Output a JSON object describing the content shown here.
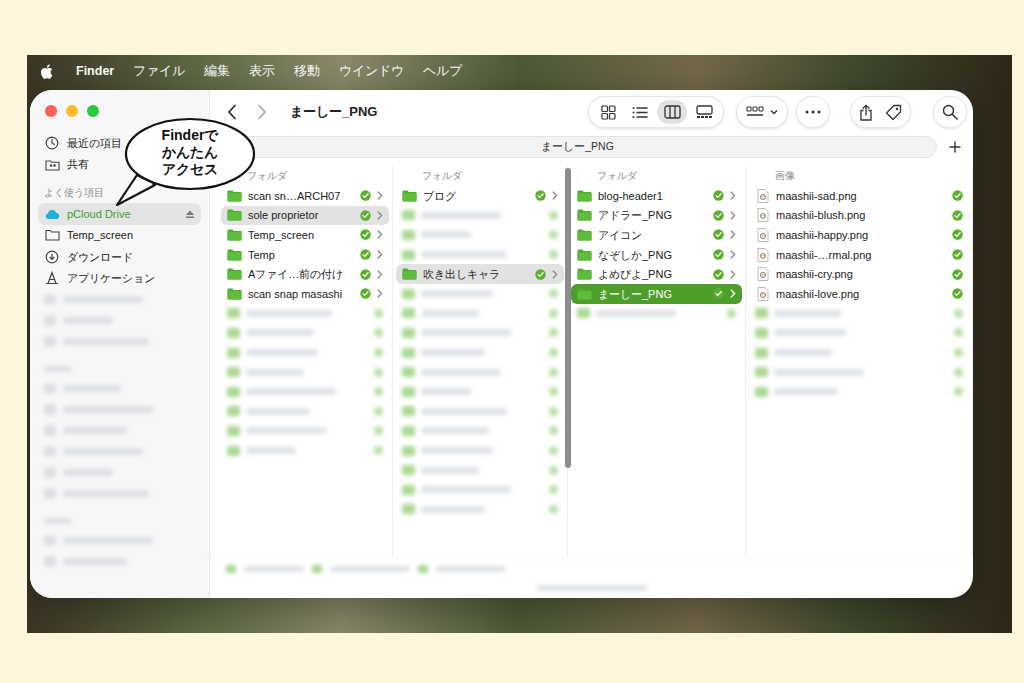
{
  "menu_bar": {
    "app": "Finder",
    "menus": [
      "ファイル",
      "編集",
      "表示",
      "移動",
      "ウインドウ",
      "ヘルプ"
    ]
  },
  "callout": {
    "lines": [
      "Finderで",
      "かんたん",
      "アクセス"
    ]
  },
  "window": {
    "title": "まーしー_PNG"
  },
  "toolbar": {
    "views": [
      {
        "selected": false
      },
      {
        "selected": false
      },
      {
        "selected": true
      },
      {
        "selected": false
      }
    ]
  },
  "path_bar": {
    "label": "まーしー_PNG"
  },
  "sidebar": {
    "top_items": [
      {
        "label": "最近の項目",
        "selected": false
      },
      {
        "label": "共有",
        "selected": false
      }
    ],
    "sections": [
      {
        "kind": "normal",
        "title": "よく使う項目",
        "items": [
          {
            "kind": "item",
            "label": "pCloud Drive",
            "selected": true,
            "ejectable": true
          },
          {
            "kind": "item",
            "label": "Temp_screen",
            "selected": false,
            "ejectable": false
          },
          {
            "kind": "item",
            "label": "ダウンロード",
            "selected": false,
            "ejectable": false
          },
          {
            "kind": "item",
            "label": "アプリケーション",
            "selected": false,
            "ejectable": false
          },
          {
            "kind": "blurred",
            "selected": false
          },
          {
            "kind": "blurred",
            "selected": false
          },
          {
            "kind": "blurred",
            "selected": false
          }
        ]
      },
      {
        "kind": "blurred",
        "items": [
          {
            "kind": "blurred",
            "selected": false
          },
          {
            "kind": "blurred",
            "selected": false
          },
          {
            "kind": "blurred",
            "selected": false
          },
          {
            "kind": "blurred",
            "selected": false
          },
          {
            "kind": "blurred",
            "selected": false
          },
          {
            "kind": "blurred",
            "selected": false
          }
        ]
      },
      {
        "kind": "blurred",
        "items": [
          {
            "kind": "blurred",
            "selected": false
          },
          {
            "kind": "blurred",
            "selected": false
          }
        ]
      }
    ]
  },
  "columns": [
    {
      "header": "フォルダ",
      "focused": false,
      "items": [
        {
          "kind": "folder",
          "label": "scan sn…ARCH07",
          "selected": false,
          "synced": true
        },
        {
          "kind": "folder",
          "label": "sole proprietor",
          "selected": true,
          "synced": true
        },
        {
          "kind": "folder",
          "label": "Temp_screen",
          "selected": false,
          "synced": true
        },
        {
          "kind": "folder",
          "label": "Temp",
          "selected": false,
          "synced": true
        },
        {
          "kind": "folder",
          "label": "Aファイ…前の付け",
          "selected": false,
          "synced": true
        },
        {
          "kind": "folder",
          "label": "scan snap masashi",
          "selected": false,
          "synced": true
        },
        {
          "kind": "blurred",
          "selected": false
        },
        {
          "kind": "blurred",
          "selected": false
        },
        {
          "kind": "blurred",
          "selected": false
        },
        {
          "kind": "blurred",
          "selected": false
        },
        {
          "kind": "blurred",
          "selected": false
        },
        {
          "kind": "blurred",
          "selected": false
        },
        {
          "kind": "blurred",
          "selected": false
        },
        {
          "kind": "blurred",
          "selected": false
        }
      ]
    },
    {
      "header": "フォルダ",
      "focused": false,
      "items": [
        {
          "kind": "folder",
          "label": "ブログ",
          "selected": false,
          "synced": true
        },
        {
          "kind": "blurred",
          "selected": false
        },
        {
          "kind": "blurred",
          "selected": false
        },
        {
          "kind": "blurred",
          "selected": false
        },
        {
          "kind": "folder",
          "label": "吹き出しキャラ",
          "selected": true,
          "synced": true
        },
        {
          "kind": "blurred",
          "selected": false
        },
        {
          "kind": "blurred",
          "selected": false
        },
        {
          "kind": "blurred",
          "selected": false
        },
        {
          "kind": "blurred",
          "selected": false
        },
        {
          "kind": "blurred",
          "selected": false
        },
        {
          "kind": "blurred",
          "selected": false
        },
        {
          "kind": "blurred",
          "selected": false
        },
        {
          "kind": "blurred",
          "selected": false
        },
        {
          "kind": "blurred",
          "selected": false
        },
        {
          "kind": "blurred",
          "selected": false
        },
        {
          "kind": "blurred",
          "selected": false
        },
        {
          "kind": "blurred",
          "selected": false
        }
      ]
    },
    {
      "header": "フォルダ",
      "focused": true,
      "items": [
        {
          "kind": "folder",
          "label": "blog-header1",
          "selected": false,
          "synced": true
        },
        {
          "kind": "folder",
          "label": "アドラー_PNG",
          "selected": false,
          "synced": true
        },
        {
          "kind": "folder",
          "label": "アイコン",
          "selected": false,
          "synced": true
        },
        {
          "kind": "folder",
          "label": "なぞしか_PNG",
          "selected": false,
          "synced": true
        },
        {
          "kind": "folder",
          "label": "よめぴよ_PNG",
          "selected": false,
          "synced": true
        },
        {
          "kind": "folder",
          "label": "まーしー_PNG",
          "selected": true,
          "synced": true
        },
        {
          "kind": "blurred",
          "selected": false
        }
      ]
    },
    {
      "header": "画像",
      "focused": false,
      "items": [
        {
          "kind": "file",
          "label": "maashii-sad.png",
          "selected": false,
          "synced": true
        },
        {
          "kind": "file",
          "label": "maashii-blush.png",
          "selected": false,
          "synced": true
        },
        {
          "kind": "file",
          "label": "maashii-happy.png",
          "selected": false,
          "synced": true
        },
        {
          "kind": "file",
          "label": "maashii-…rmal.png",
          "selected": false,
          "synced": true
        },
        {
          "kind": "file",
          "label": "maashii-cry.png",
          "selected": false,
          "synced": true
        },
        {
          "kind": "file",
          "label": "maashii-love.png",
          "selected": false,
          "synced": true
        },
        {
          "kind": "blurred",
          "selected": false
        },
        {
          "kind": "blurred",
          "selected": false
        },
        {
          "kind": "blurred",
          "selected": false
        },
        {
          "kind": "blurred",
          "selected": false
        },
        {
          "kind": "blurred",
          "selected": false
        }
      ]
    }
  ]
}
